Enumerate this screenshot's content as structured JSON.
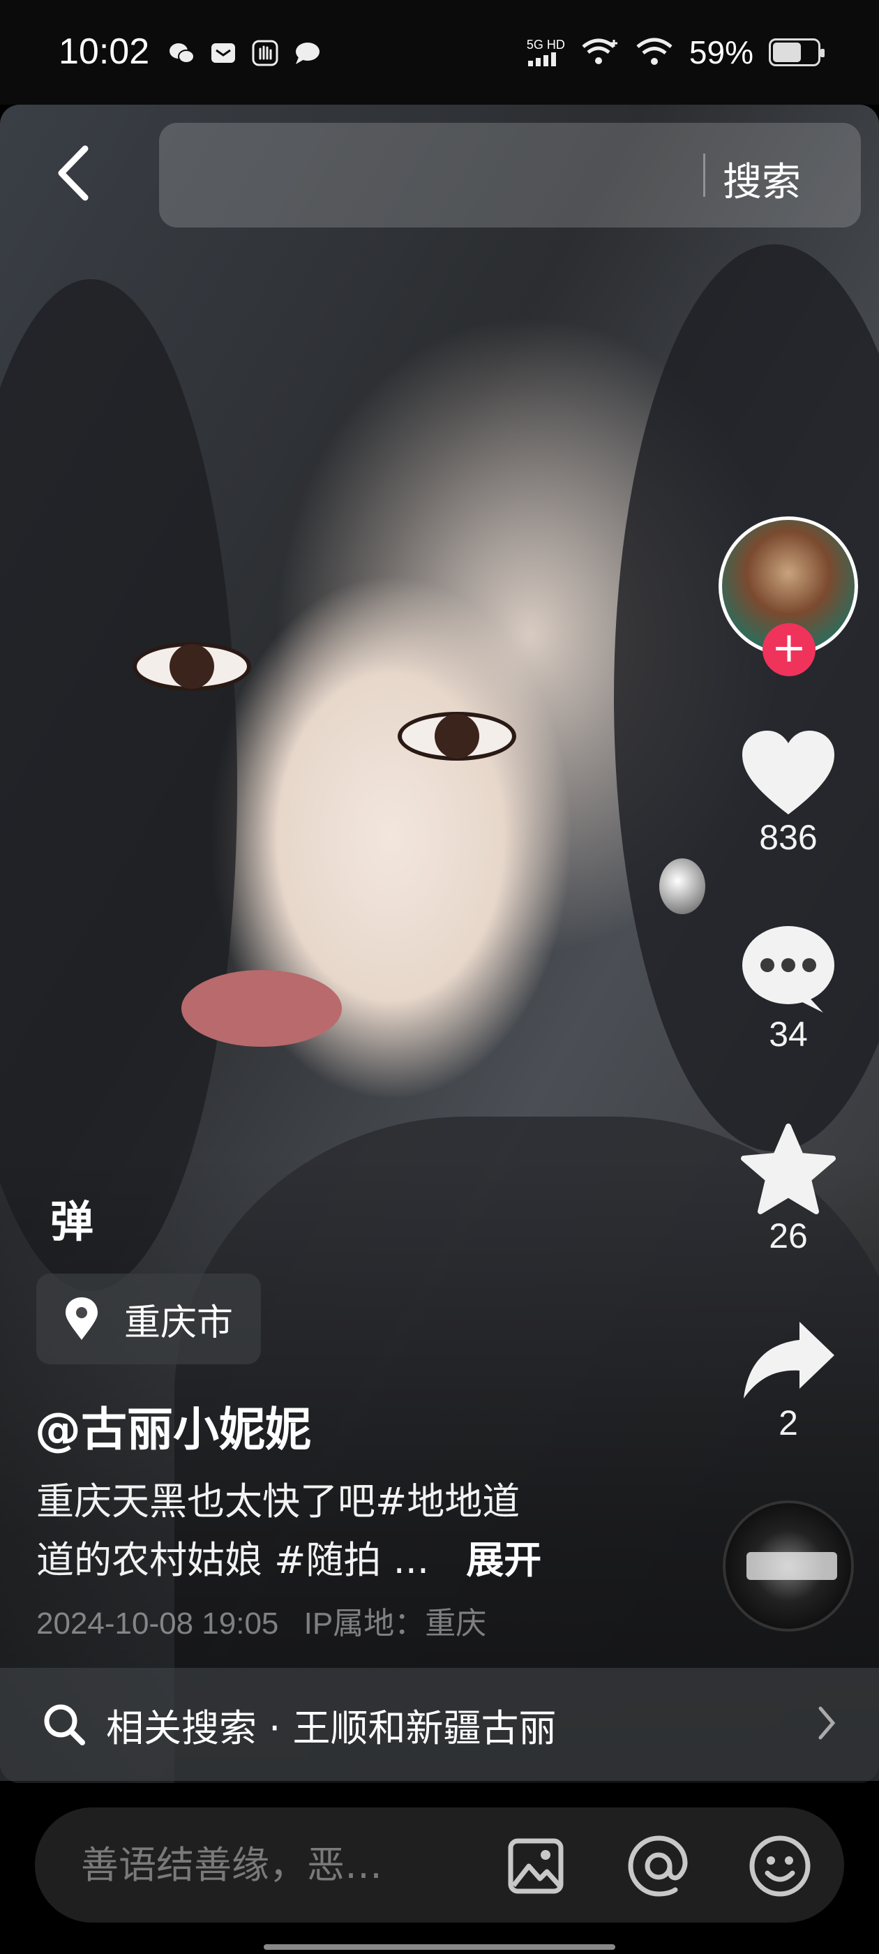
{
  "status_bar": {
    "time": "10:02",
    "network": "5G HD",
    "battery_percent": "59%",
    "notification_icons": [
      "wechat-icon",
      "message-icon",
      "hand-icon",
      "chat-bubble-icon"
    ]
  },
  "top_bar": {
    "search_input_value": "",
    "search_button_label": "搜索"
  },
  "actions": {
    "likes": "836",
    "comments": "34",
    "favorites": "26",
    "shares": "2"
  },
  "danmu_label": "弹",
  "location": "重庆市",
  "post": {
    "author": "@古丽小妮妮",
    "caption_line1": "重庆天黑也太快了吧#地地道",
    "caption_line2": "道的农村姑娘 #随拍 ...",
    "expand_label": "展开",
    "datetime": "2024-10-08 19:05",
    "ip_location": "IP属地：重庆"
  },
  "related_search": "相关搜索 · 王顺和新疆古丽",
  "comment_bar": {
    "placeholder": "善语结善缘，恶…"
  },
  "colors": {
    "follow_badge": "#f0335b",
    "background": "#000000"
  }
}
